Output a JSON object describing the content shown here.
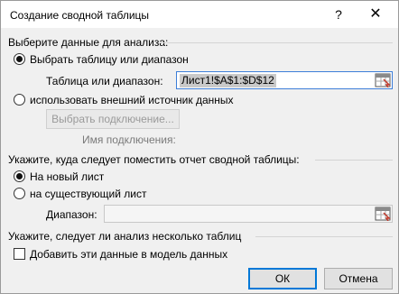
{
  "window": {
    "title": "Создание сводной таблицы",
    "help_glyph": "?",
    "close_glyph": "✕"
  },
  "source_section": {
    "heading": "Выберите данные для анализа:",
    "option_table": {
      "label": "Выбрать таблицу или диапазон",
      "selected": true
    },
    "range_field": {
      "label": "Таблица или диапазон:",
      "value": "Лист1!$A$1:$D$12"
    },
    "option_external": {
      "label": "использовать внешний источник данных",
      "selected": false
    },
    "choose_connection_button": "Выбрать подключение...",
    "connection_name_label": "Имя подключения:"
  },
  "placement_section": {
    "heading": "Укажите, куда следует поместить отчет сводной таблицы:",
    "option_new_sheet": {
      "label": "На новый лист",
      "selected": true
    },
    "option_existing_sheet": {
      "label": "на существующий лист",
      "selected": false
    },
    "location_field": {
      "label": "Диапазон:",
      "value": ""
    }
  },
  "model_section": {
    "heading": "Укажите, следует ли анализ несколько таблиц",
    "add_to_model": {
      "label": "Добавить эти данные в модель данных",
      "checked": false
    }
  },
  "buttons": {
    "ok": "ОК",
    "cancel": "Отмена"
  }
}
